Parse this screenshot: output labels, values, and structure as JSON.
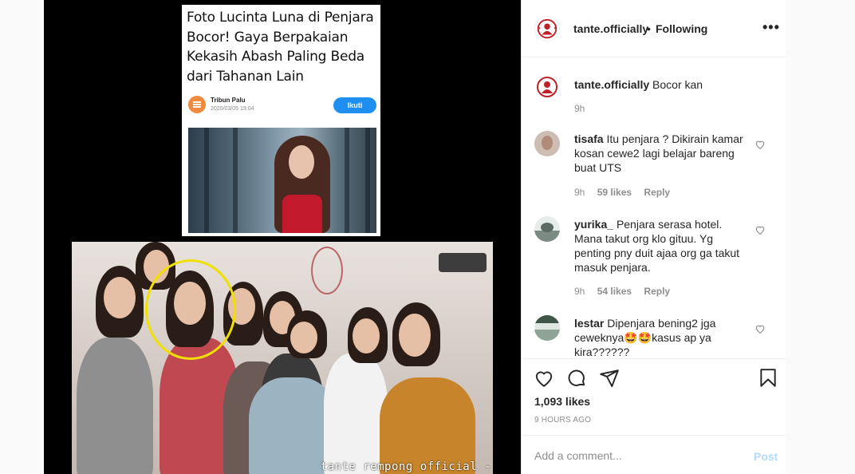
{
  "article": {
    "headline": "Foto Lucinta Luna di Penjara Bocor! Gaya Berpakaian Kekasih Abash Paling Beda dari Tahanan Lain",
    "source_name": "Tribun Palu",
    "source_date": "2020/03/05 19:04",
    "follow_label": "Ikuti"
  },
  "photo": {
    "watermark": "tante rempong official -"
  },
  "header": {
    "username": "tante.officially",
    "separator": "•",
    "follow_status": "Following",
    "more_icon": "more-horizontal-icon"
  },
  "comments": [
    {
      "user": "tante.officially",
      "text": "Bocor kan",
      "time": "9h",
      "likes": "",
      "reply": ""
    },
    {
      "user": "tisafa",
      "text": "Itu penjara ? Dikirain kamar kosan cewe2 lagi belajar bareng buat UTS",
      "time": "9h",
      "likes": "59 likes",
      "reply": "Reply"
    },
    {
      "user": "yurika_",
      "text": "Penjara serasa hotel. Mana takut org klo gituu. Yg penting pny duit ajaa org ga takut masuk penjara.",
      "time": "9h",
      "likes": "54 likes",
      "reply": "Reply"
    },
    {
      "user": "lestar",
      "text": "Dipenjara bening2 jga ceweknya🤩🤩kasus ap ya kira??????",
      "time": "",
      "likes": "",
      "reply": ""
    }
  ],
  "actions": {
    "icons": [
      "heart-icon",
      "comment-icon",
      "share-icon",
      "bookmark-icon"
    ],
    "likes": "1,093 likes",
    "time": "9 HOURS AGO"
  },
  "add_comment": {
    "placeholder": "Add a comment...",
    "post_label": "Post"
  },
  "colors": {
    "accent_blue": "#0095f6",
    "post_disabled": "#b3dbff",
    "follow_button": "#1e8ff0",
    "highlight": "#f0e000",
    "logo_red": "#c0202a"
  }
}
